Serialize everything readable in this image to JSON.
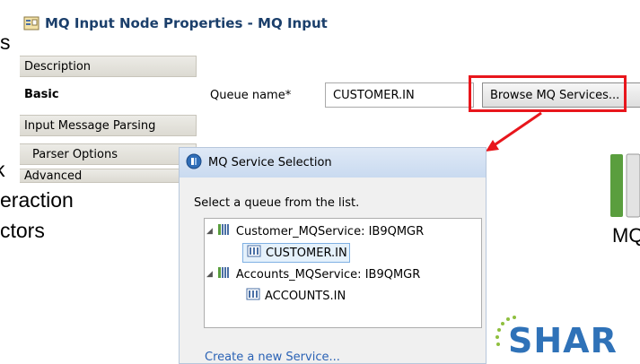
{
  "window": {
    "title": "MQ Input Node Properties - MQ Input"
  },
  "slide_fragments": {
    "line1": "s",
    "line2": "k",
    "line3": "eraction",
    "line4": "ctors"
  },
  "sidebar": {
    "items": [
      {
        "label": "Description"
      },
      {
        "label": "Basic"
      },
      {
        "label": "Input Message Parsing"
      },
      {
        "label": "Parser Options"
      },
      {
        "label": "Advanced"
      }
    ]
  },
  "basic": {
    "queue_label": "Queue name*",
    "queue_value": "CUSTOMER.IN",
    "browse_label": "Browse MQ Services..."
  },
  "dialog": {
    "title": "MQ Service Selection",
    "instruction": "Select a queue from the list.",
    "tree": [
      {
        "label": "Customer_MQService: IB9QMGR"
      },
      {
        "label": "CUSTOMER.IN"
      },
      {
        "label": "Accounts_MQService: IB9QMGR"
      },
      {
        "label": "ACCOUNTS.IN"
      }
    ],
    "create_link": "Create a new Service..."
  },
  "background_logo": {
    "mq_text": "MQ",
    "share_text": "SHAR"
  },
  "colors": {
    "highlight": "#e8161c",
    "title_text": "#1b3f6b",
    "link": "#2a62b5",
    "share_blue": "#2f72b8",
    "mq_green": "#5a9e3e"
  }
}
